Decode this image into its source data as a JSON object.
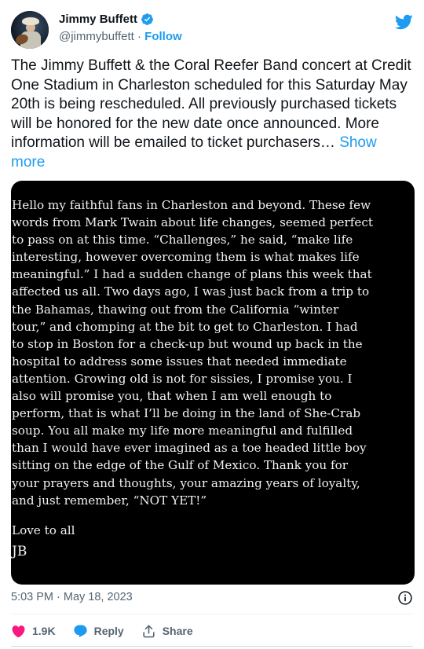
{
  "author": {
    "name": "Jimmy Buffett",
    "handle": "@jimmybuffett",
    "separator": "·",
    "follow_label": "Follow"
  },
  "tweet": {
    "text": "The Jimmy Buffett & the Coral Reefer Band concert at Credit One Stadium in Charleston scheduled for this Saturday May 20th is being rescheduled. All previously purchased tickets will be honored for the new date once announced. More information will be emailed to ticket purchasers…",
    "show_more_label": "Show more"
  },
  "letter": {
    "body": "Hello my faithful fans in Charleston and beyond. These few\nwords from Mark Twain about life changes, seemed perfect\nto pass on at this time. “Challenges,” he said, “make life\ninteresting, however overcoming them is what makes life\nmeaningful.” I had a sudden change of plans this week that\naffected us all. Two days ago, I was just back from a trip to\nthe Bahamas, thawing out from the California “winter\ntour,” and chomping at the bit to get to Charleston. I had\nto stop in Boston for a check-up but wound up back in the\nhospital to address some issues that needed immediate\nattention. Growing old is not for sissies, I promise you. I\nalso will promise you, that when I am well enough to\nperform, that is what I’ll be doing in the land of She-Crab\nsoup. You all make my life more meaningful and fulfilled\nthan I would have ever imagined as a toe headed little boy\nsitting on the edge of the Gulf of Mexico. Thank you for\nyour prayers and thoughts, your amazing years of loyalty,\nand just remember, “NOT YET!”",
    "closing": "Love to all",
    "signature": "JB"
  },
  "meta": {
    "timestamp": "5:03 PM · May 18, 2023"
  },
  "actions": {
    "like_count": "1.9K",
    "reply_label": "Reply",
    "share_label": "Share"
  },
  "colors": {
    "accent": "#1d9bf0",
    "like": "#f91880",
    "text": "#0f1419",
    "muted": "#536471"
  },
  "icons": [
    "verified-badge-icon",
    "twitter-bird-icon",
    "info-icon",
    "heart-icon",
    "reply-bubble-icon",
    "share-icon"
  ]
}
